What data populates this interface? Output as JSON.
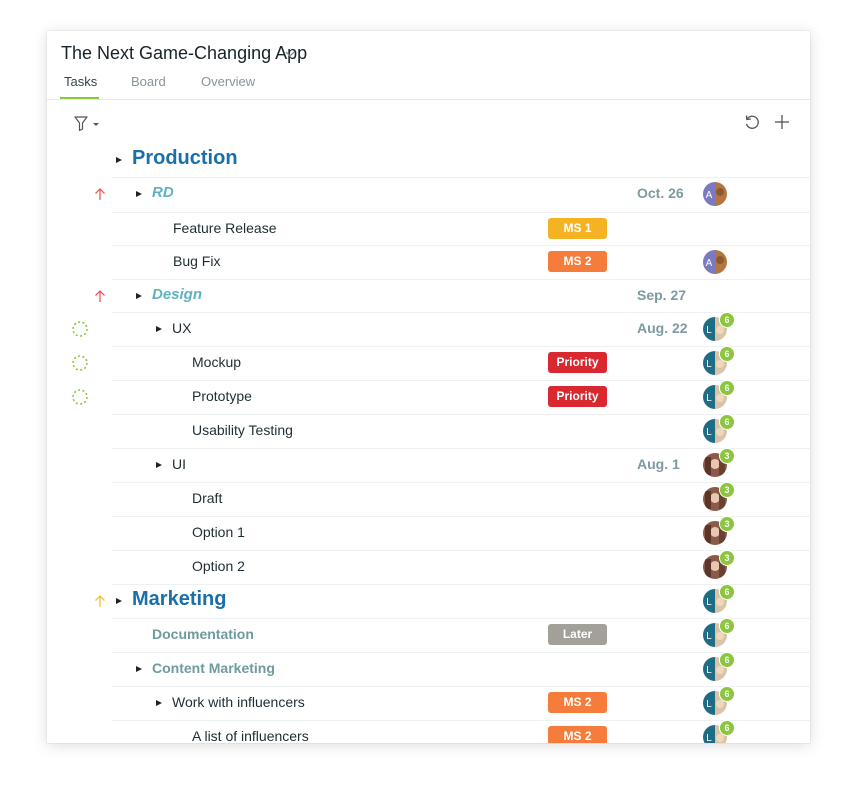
{
  "header": {
    "title": "The Next Game-Changing App",
    "tabs": [
      {
        "label": "Tasks",
        "active": true
      },
      {
        "label": "Board",
        "active": false
      },
      {
        "label": "Overview",
        "active": false
      }
    ]
  },
  "toolbar": {
    "filter_icon": "filter-icon",
    "refresh_icon": "refresh-icon",
    "add_icon": "add-icon"
  },
  "colors": {
    "accent_green": "#8cc63f",
    "section_blue": "#1a6fa8",
    "subsection_teal": "#5fb3bd",
    "badge_ms1": "#f5b324",
    "badge_ms2": "#f57c3b",
    "badge_priority": "#d9282f",
    "badge_later": "#a3a09a",
    "arrow_red": "#e85a5a",
    "arrow_yellow": "#f2c232"
  },
  "tasks": [
    {
      "label": "Production",
      "style": "section",
      "expanded": true
    },
    {
      "label": "RD",
      "style": "group",
      "expanded": true,
      "date": "Oct. 26",
      "indicator": "arrow-up-red",
      "avatar": "A"
    },
    {
      "label": "Feature Release",
      "style": "task",
      "badge": {
        "text": "MS 1",
        "kind": "ms1"
      }
    },
    {
      "label": "Bug Fix",
      "style": "task",
      "badge": {
        "text": "MS 2",
        "kind": "ms2"
      },
      "avatar": "A"
    },
    {
      "label": "Design",
      "style": "group",
      "expanded": true,
      "date": "Sep. 27",
      "indicator": "arrow-up-red"
    },
    {
      "label": "UX",
      "style": "subtask",
      "expanded": true,
      "date": "Aug. 22",
      "indicator": "progress-spinner",
      "avatar": "L",
      "count": "6"
    },
    {
      "label": "Mockup",
      "style": "leaf",
      "badge": {
        "text": "Priority",
        "kind": "priority"
      },
      "indicator": "progress-spinner",
      "avatar": "L",
      "count": "6"
    },
    {
      "label": "Prototype",
      "style": "leaf",
      "badge": {
        "text": "Priority",
        "kind": "priority"
      },
      "indicator": "progress-spinner",
      "avatar": "L",
      "count": "6"
    },
    {
      "label": "Usability Testing",
      "style": "leaf",
      "avatar": "L",
      "count": "6"
    },
    {
      "label": "UI",
      "style": "subtask",
      "expanded": true,
      "date": "Aug. 1",
      "avatar": "photo",
      "count": "3"
    },
    {
      "label": "Draft",
      "style": "leaf",
      "avatar": "photo",
      "count": "3"
    },
    {
      "label": "Option 1",
      "style": "leaf",
      "avatar": "photo",
      "count": "3"
    },
    {
      "label": "Option 2",
      "style": "leaf",
      "avatar": "photo",
      "count": "3"
    },
    {
      "label": "Marketing",
      "style": "section",
      "expanded": true,
      "indicator": "arrow-up-yellow",
      "avatar": "L",
      "count": "6"
    },
    {
      "label": "Documentation",
      "style": "group-plain",
      "badge": {
        "text": "Later",
        "kind": "later"
      },
      "avatar": "L",
      "count": "6"
    },
    {
      "label": "Content Marketing",
      "style": "group-plain",
      "expanded": true,
      "avatar": "L",
      "count": "6"
    },
    {
      "label": "Work with influencers",
      "style": "task",
      "expanded": true,
      "badge": {
        "text": "MS 2",
        "kind": "ms2"
      },
      "avatar": "L",
      "count": "6"
    },
    {
      "label": "A list of influencers",
      "style": "leaf",
      "badge": {
        "text": "MS 2",
        "kind": "ms2"
      },
      "avatar": "L",
      "count": "6"
    }
  ]
}
